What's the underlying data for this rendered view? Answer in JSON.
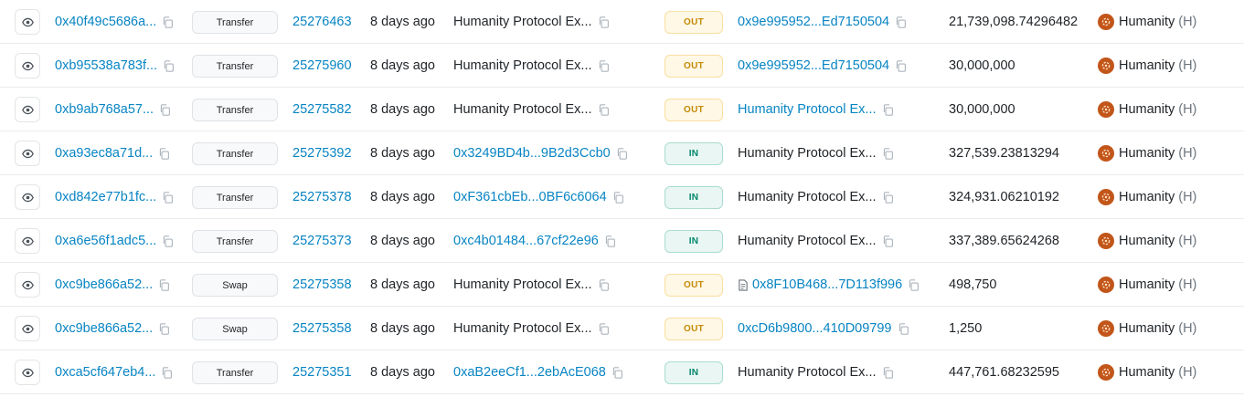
{
  "rows": [
    {
      "hash": "0x40f49c5686a...",
      "method": "Transfer",
      "block": "25276463",
      "age": "8 days ago",
      "from": "Humanity Protocol Ex...",
      "from_link": false,
      "direction": "OUT",
      "to": "0x9e995952...Ed7150504",
      "to_link": true,
      "to_contract": false,
      "amount": "21,739,098.74296482",
      "token": "Humanity",
      "symbol": "(H)"
    },
    {
      "hash": "0xb95538a783f...",
      "method": "Transfer",
      "block": "25275960",
      "age": "8 days ago",
      "from": "Humanity Protocol Ex...",
      "from_link": false,
      "direction": "OUT",
      "to": "0x9e995952...Ed7150504",
      "to_link": true,
      "to_contract": false,
      "amount": "30,000,000",
      "token": "Humanity",
      "symbol": "(H)"
    },
    {
      "hash": "0xb9ab768a57...",
      "method": "Transfer",
      "block": "25275582",
      "age": "8 days ago",
      "from": "Humanity Protocol Ex...",
      "from_link": false,
      "direction": "OUT",
      "to": "Humanity Protocol Ex...",
      "to_link": true,
      "to_contract": false,
      "amount": "30,000,000",
      "token": "Humanity",
      "symbol": "(H)"
    },
    {
      "hash": "0xa93ec8a71d...",
      "method": "Transfer",
      "block": "25275392",
      "age": "8 days ago",
      "from": "0x3249BD4b...9B2d3Ccb0",
      "from_link": true,
      "direction": "IN",
      "to": "Humanity Protocol Ex...",
      "to_link": false,
      "to_contract": false,
      "amount": "327,539.23813294",
      "token": "Humanity",
      "symbol": "(H)"
    },
    {
      "hash": "0xd842e77b1fc...",
      "method": "Transfer",
      "block": "25275378",
      "age": "8 days ago",
      "from": "0xF361cbEb...0BF6c6064",
      "from_link": true,
      "direction": "IN",
      "to": "Humanity Protocol Ex...",
      "to_link": false,
      "to_contract": false,
      "amount": "324,931.06210192",
      "token": "Humanity",
      "symbol": "(H)"
    },
    {
      "hash": "0xa6e56f1adc5...",
      "method": "Transfer",
      "block": "25275373",
      "age": "8 days ago",
      "from": "0xc4b01484...67cf22e96",
      "from_link": true,
      "direction": "IN",
      "to": "Humanity Protocol Ex...",
      "to_link": false,
      "to_contract": false,
      "amount": "337,389.65624268",
      "token": "Humanity",
      "symbol": "(H)"
    },
    {
      "hash": "0xc9be866a52...",
      "method": "Swap",
      "block": "25275358",
      "age": "8 days ago",
      "from": "Humanity Protocol Ex...",
      "from_link": false,
      "direction": "OUT",
      "to": "0x8F10B468...7D113f996",
      "to_link": true,
      "to_contract": true,
      "amount": "498,750",
      "token": "Humanity",
      "symbol": "(H)"
    },
    {
      "hash": "0xc9be866a52...",
      "method": "Swap",
      "block": "25275358",
      "age": "8 days ago",
      "from": "Humanity Protocol Ex...",
      "from_link": false,
      "direction": "OUT",
      "to": "0xcD6b9800...410D09799",
      "to_link": true,
      "to_contract": false,
      "amount": "1,250",
      "token": "Humanity",
      "symbol": "(H)"
    },
    {
      "hash": "0xca5cf647eb4...",
      "method": "Transfer",
      "block": "25275351",
      "age": "8 days ago",
      "from": "0xaB2eeCf1...2ebAcE068",
      "from_link": true,
      "direction": "IN",
      "to": "Humanity Protocol Ex...",
      "to_link": false,
      "to_contract": false,
      "amount": "447,761.68232595",
      "token": "Humanity",
      "symbol": "(H)"
    }
  ],
  "colors": {
    "link": "#0784c3",
    "out_badge": "#c48a06",
    "in_badge": "#00866b",
    "token_logo": "#c2561a"
  }
}
